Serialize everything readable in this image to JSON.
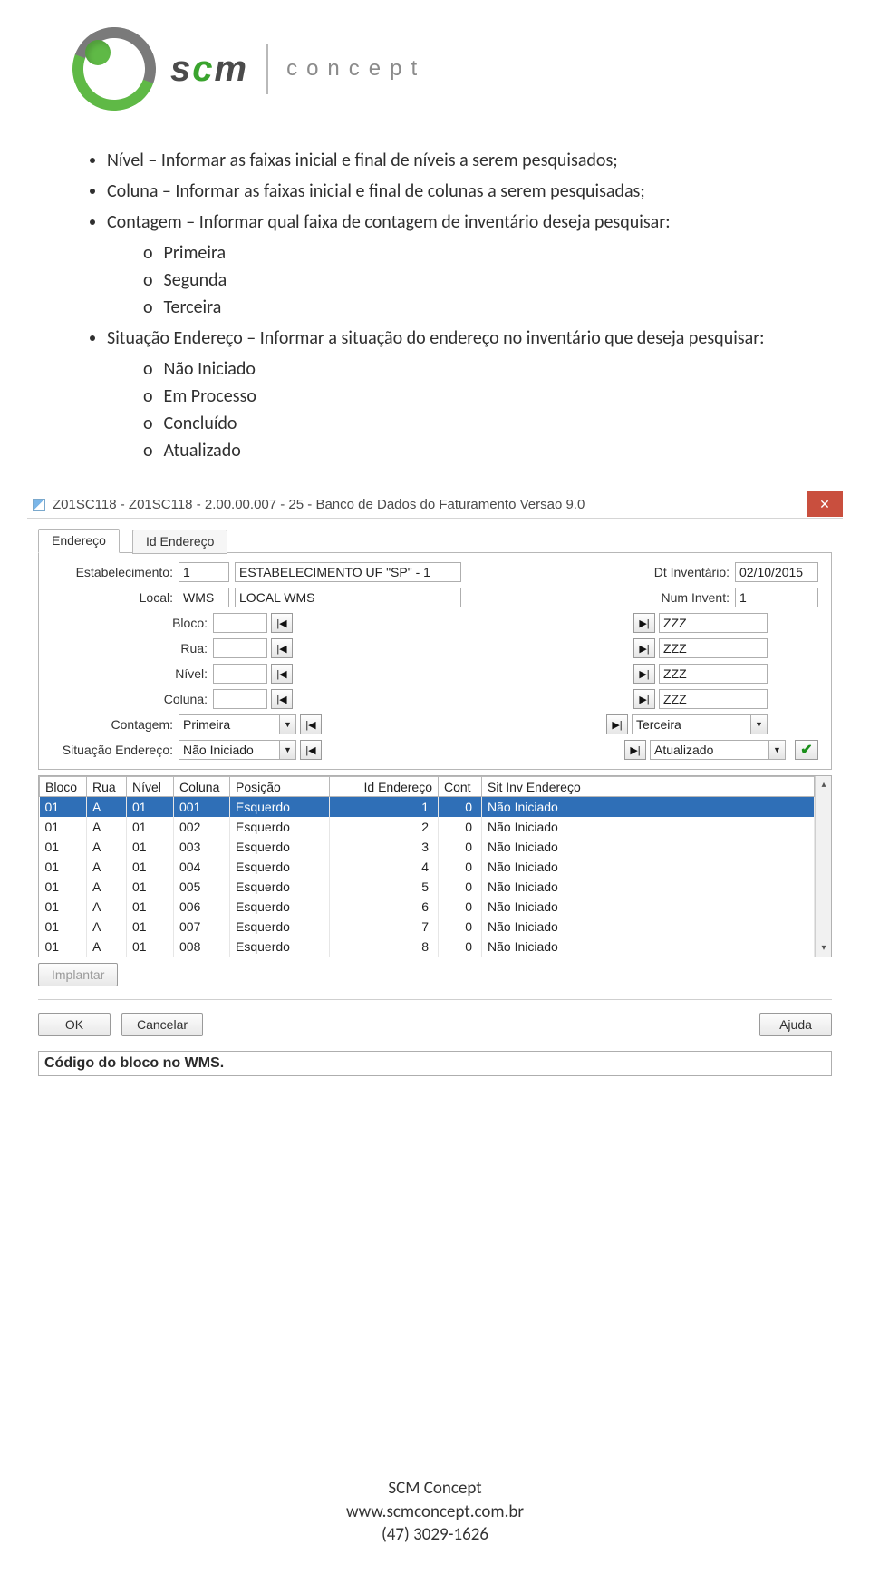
{
  "logo": {
    "scm": "scm",
    "concept": "concept"
  },
  "bullets": {
    "nivel": "Nível – Informar as faixas inicial e final de níveis a serem pesquisados;",
    "coluna": "Coluna – Informar as faixas inicial e final de colunas a serem pesquisadas;",
    "contagem": "Contagem – Informar qual faixa de contagem de inventário deseja pesquisar:",
    "contagem_itens": {
      "a": "Primeira",
      "b": "Segunda",
      "c": "Terceira"
    },
    "situacao": "Situação Endereço – Informar a situação do endereço no inventário que deseja pesquisar:",
    "situacao_itens": {
      "a": "Não Iniciado",
      "b": "Em Processo",
      "c": "Concluído",
      "d": "Atualizado"
    }
  },
  "window": {
    "title": "Z01SC118 - Z01SC118 - 2.00.00.007 - 25 - Banco de Dados do Faturamento Versao 9.0",
    "tabs": {
      "endereco": "Endereço",
      "id": "Id Endereço"
    },
    "labels": {
      "estab": "Estabelecimento:",
      "local": "Local:",
      "dt": "Dt Inventário:",
      "num": "Num Invent:",
      "bloco": "Bloco:",
      "rua": "Rua:",
      "nivel": "Nível:",
      "coluna": "Coluna:",
      "contagem": "Contagem:",
      "sit": "Situação Endereço:"
    },
    "values": {
      "estab_code": "1",
      "estab_desc": "ESTABELECIMENTO UF \"SP\" - 1",
      "local_code": "WMS",
      "local_desc": "LOCAL WMS",
      "dt": "02/10/2015",
      "num": "1",
      "zzz": "ZZZ",
      "contagem_from": "Primeira",
      "contagem_to": "Terceira",
      "sit_from": "Não Iniciado",
      "sit_to": "Atualizado"
    },
    "grid": {
      "headers": {
        "bloco": "Bloco",
        "rua": "Rua",
        "nivel": "Nível",
        "coluna": "Coluna",
        "pos": "Posição",
        "id": "Id Endereço",
        "cont": "Cont",
        "sit": "Sit Inv Endereço"
      },
      "rows": [
        {
          "bl": "01",
          "rua": "A",
          "niv": "01",
          "col": "001",
          "pos": "Esquerdo",
          "id": "1",
          "cont": "0",
          "sit": "Não Iniciado"
        },
        {
          "bl": "01",
          "rua": "A",
          "niv": "01",
          "col": "002",
          "pos": "Esquerdo",
          "id": "2",
          "cont": "0",
          "sit": "Não Iniciado"
        },
        {
          "bl": "01",
          "rua": "A",
          "niv": "01",
          "col": "003",
          "pos": "Esquerdo",
          "id": "3",
          "cont": "0",
          "sit": "Não Iniciado"
        },
        {
          "bl": "01",
          "rua": "A",
          "niv": "01",
          "col": "004",
          "pos": "Esquerdo",
          "id": "4",
          "cont": "0",
          "sit": "Não Iniciado"
        },
        {
          "bl": "01",
          "rua": "A",
          "niv": "01",
          "col": "005",
          "pos": "Esquerdo",
          "id": "5",
          "cont": "0",
          "sit": "Não Iniciado"
        },
        {
          "bl": "01",
          "rua": "A",
          "niv": "01",
          "col": "006",
          "pos": "Esquerdo",
          "id": "6",
          "cont": "0",
          "sit": "Não Iniciado"
        },
        {
          "bl": "01",
          "rua": "A",
          "niv": "01",
          "col": "007",
          "pos": "Esquerdo",
          "id": "7",
          "cont": "0",
          "sit": "Não Iniciado"
        },
        {
          "bl": "01",
          "rua": "A",
          "niv": "01",
          "col": "008",
          "pos": "Esquerdo",
          "id": "8",
          "cont": "0",
          "sit": "Não Iniciado"
        }
      ]
    },
    "buttons": {
      "implantar": "Implantar",
      "ok": "OK",
      "cancelar": "Cancelar",
      "ajuda": "Ajuda"
    },
    "status": "Código do bloco no WMS."
  },
  "footer": {
    "name": "SCM Concept",
    "url": "www.scmconcept.com.br",
    "phone": "(47) 3029-1626"
  }
}
